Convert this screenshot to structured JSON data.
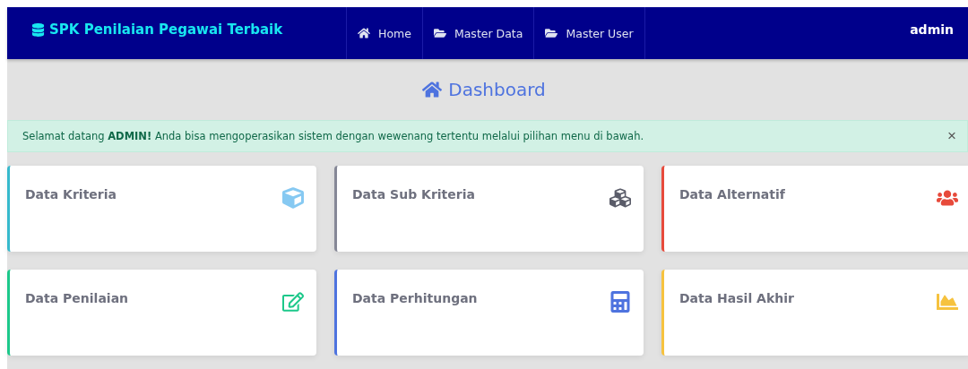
{
  "navbar": {
    "brand": "SPK Penilaian Pegawai Terbaik",
    "items": [
      {
        "label": "Home"
      },
      {
        "label": "Master Data"
      },
      {
        "label": "Master User"
      }
    ],
    "user": "admin"
  },
  "heading": "Dashboard",
  "alert": {
    "message": "Selamat datang **ADMIN!** Anda bisa mengoperasikan sistem dengan wewenang tertentu melalui pilihan menu di bawah.",
    "close": "×"
  },
  "cards": [
    {
      "title": "Data Kriteria",
      "color": "#36b9cc"
    },
    {
      "title": "Data Sub Kriteria",
      "color": "#858796"
    },
    {
      "title": "Data Alternatif",
      "color": "#e74a3b"
    },
    {
      "title": "Data Penilaian",
      "color": "#1cc88a"
    },
    {
      "title": "Data Perhitungan",
      "color": "#4e73df"
    },
    {
      "title": "Data Hasil Akhir",
      "color": "#f6c23e"
    }
  ]
}
